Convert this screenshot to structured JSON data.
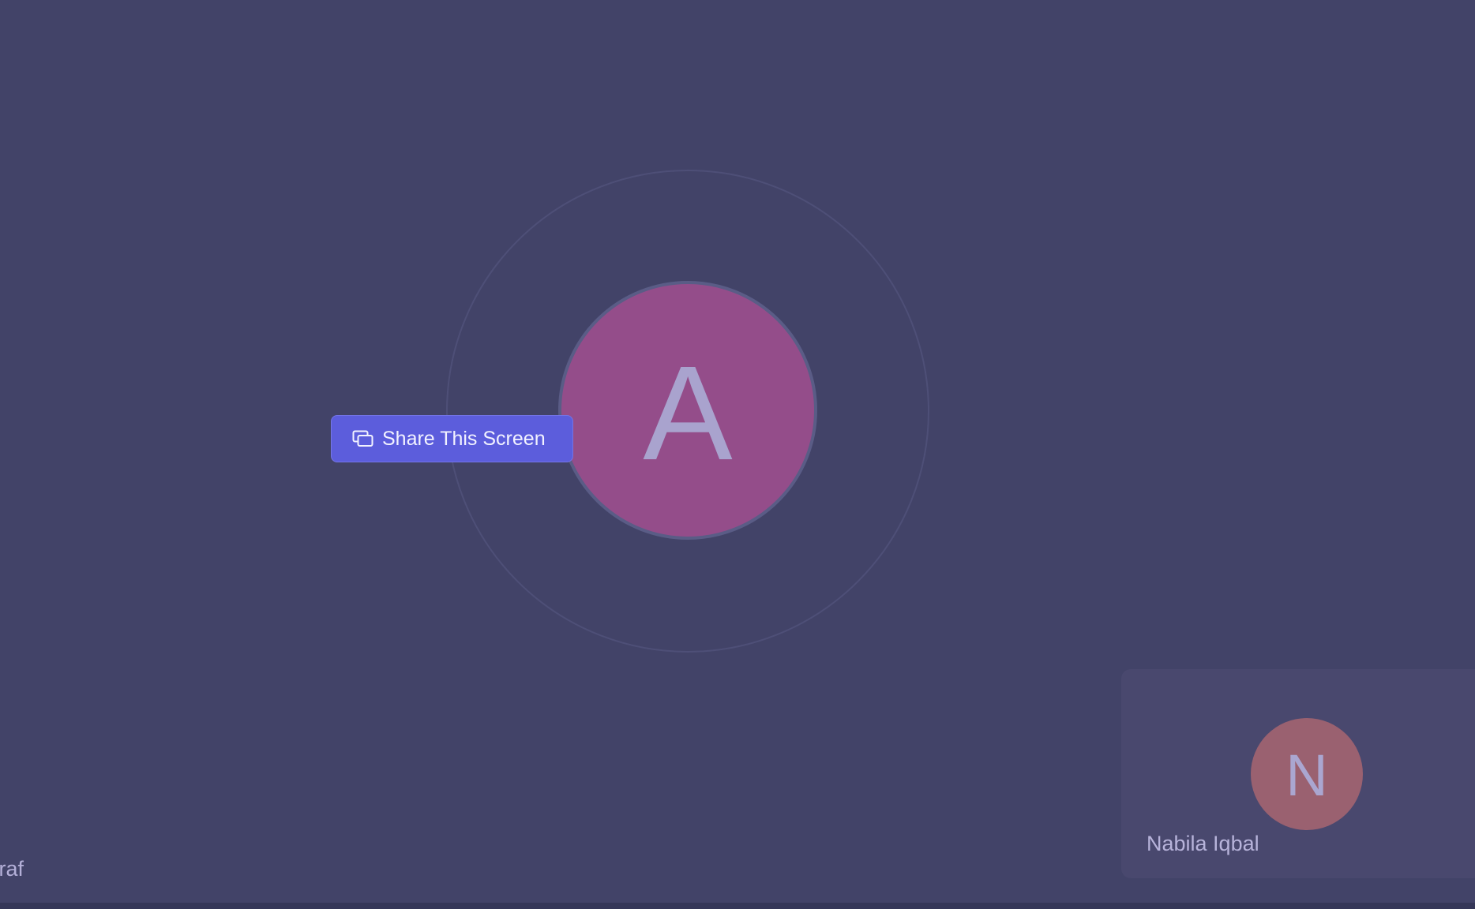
{
  "main_speaker": {
    "initial": "A",
    "name": "Ashraf",
    "avatar_color": "#944d8a"
  },
  "share_button": {
    "label": "Share This Screen",
    "icon": "screen-share-icon",
    "color": "#5c5ddc"
  },
  "participants": [
    {
      "initial": "N",
      "name": "Nabila Iqbal",
      "avatar_color": "#9a6170"
    }
  ],
  "colors": {
    "background": "#424368",
    "tile_background": "#49486e"
  }
}
